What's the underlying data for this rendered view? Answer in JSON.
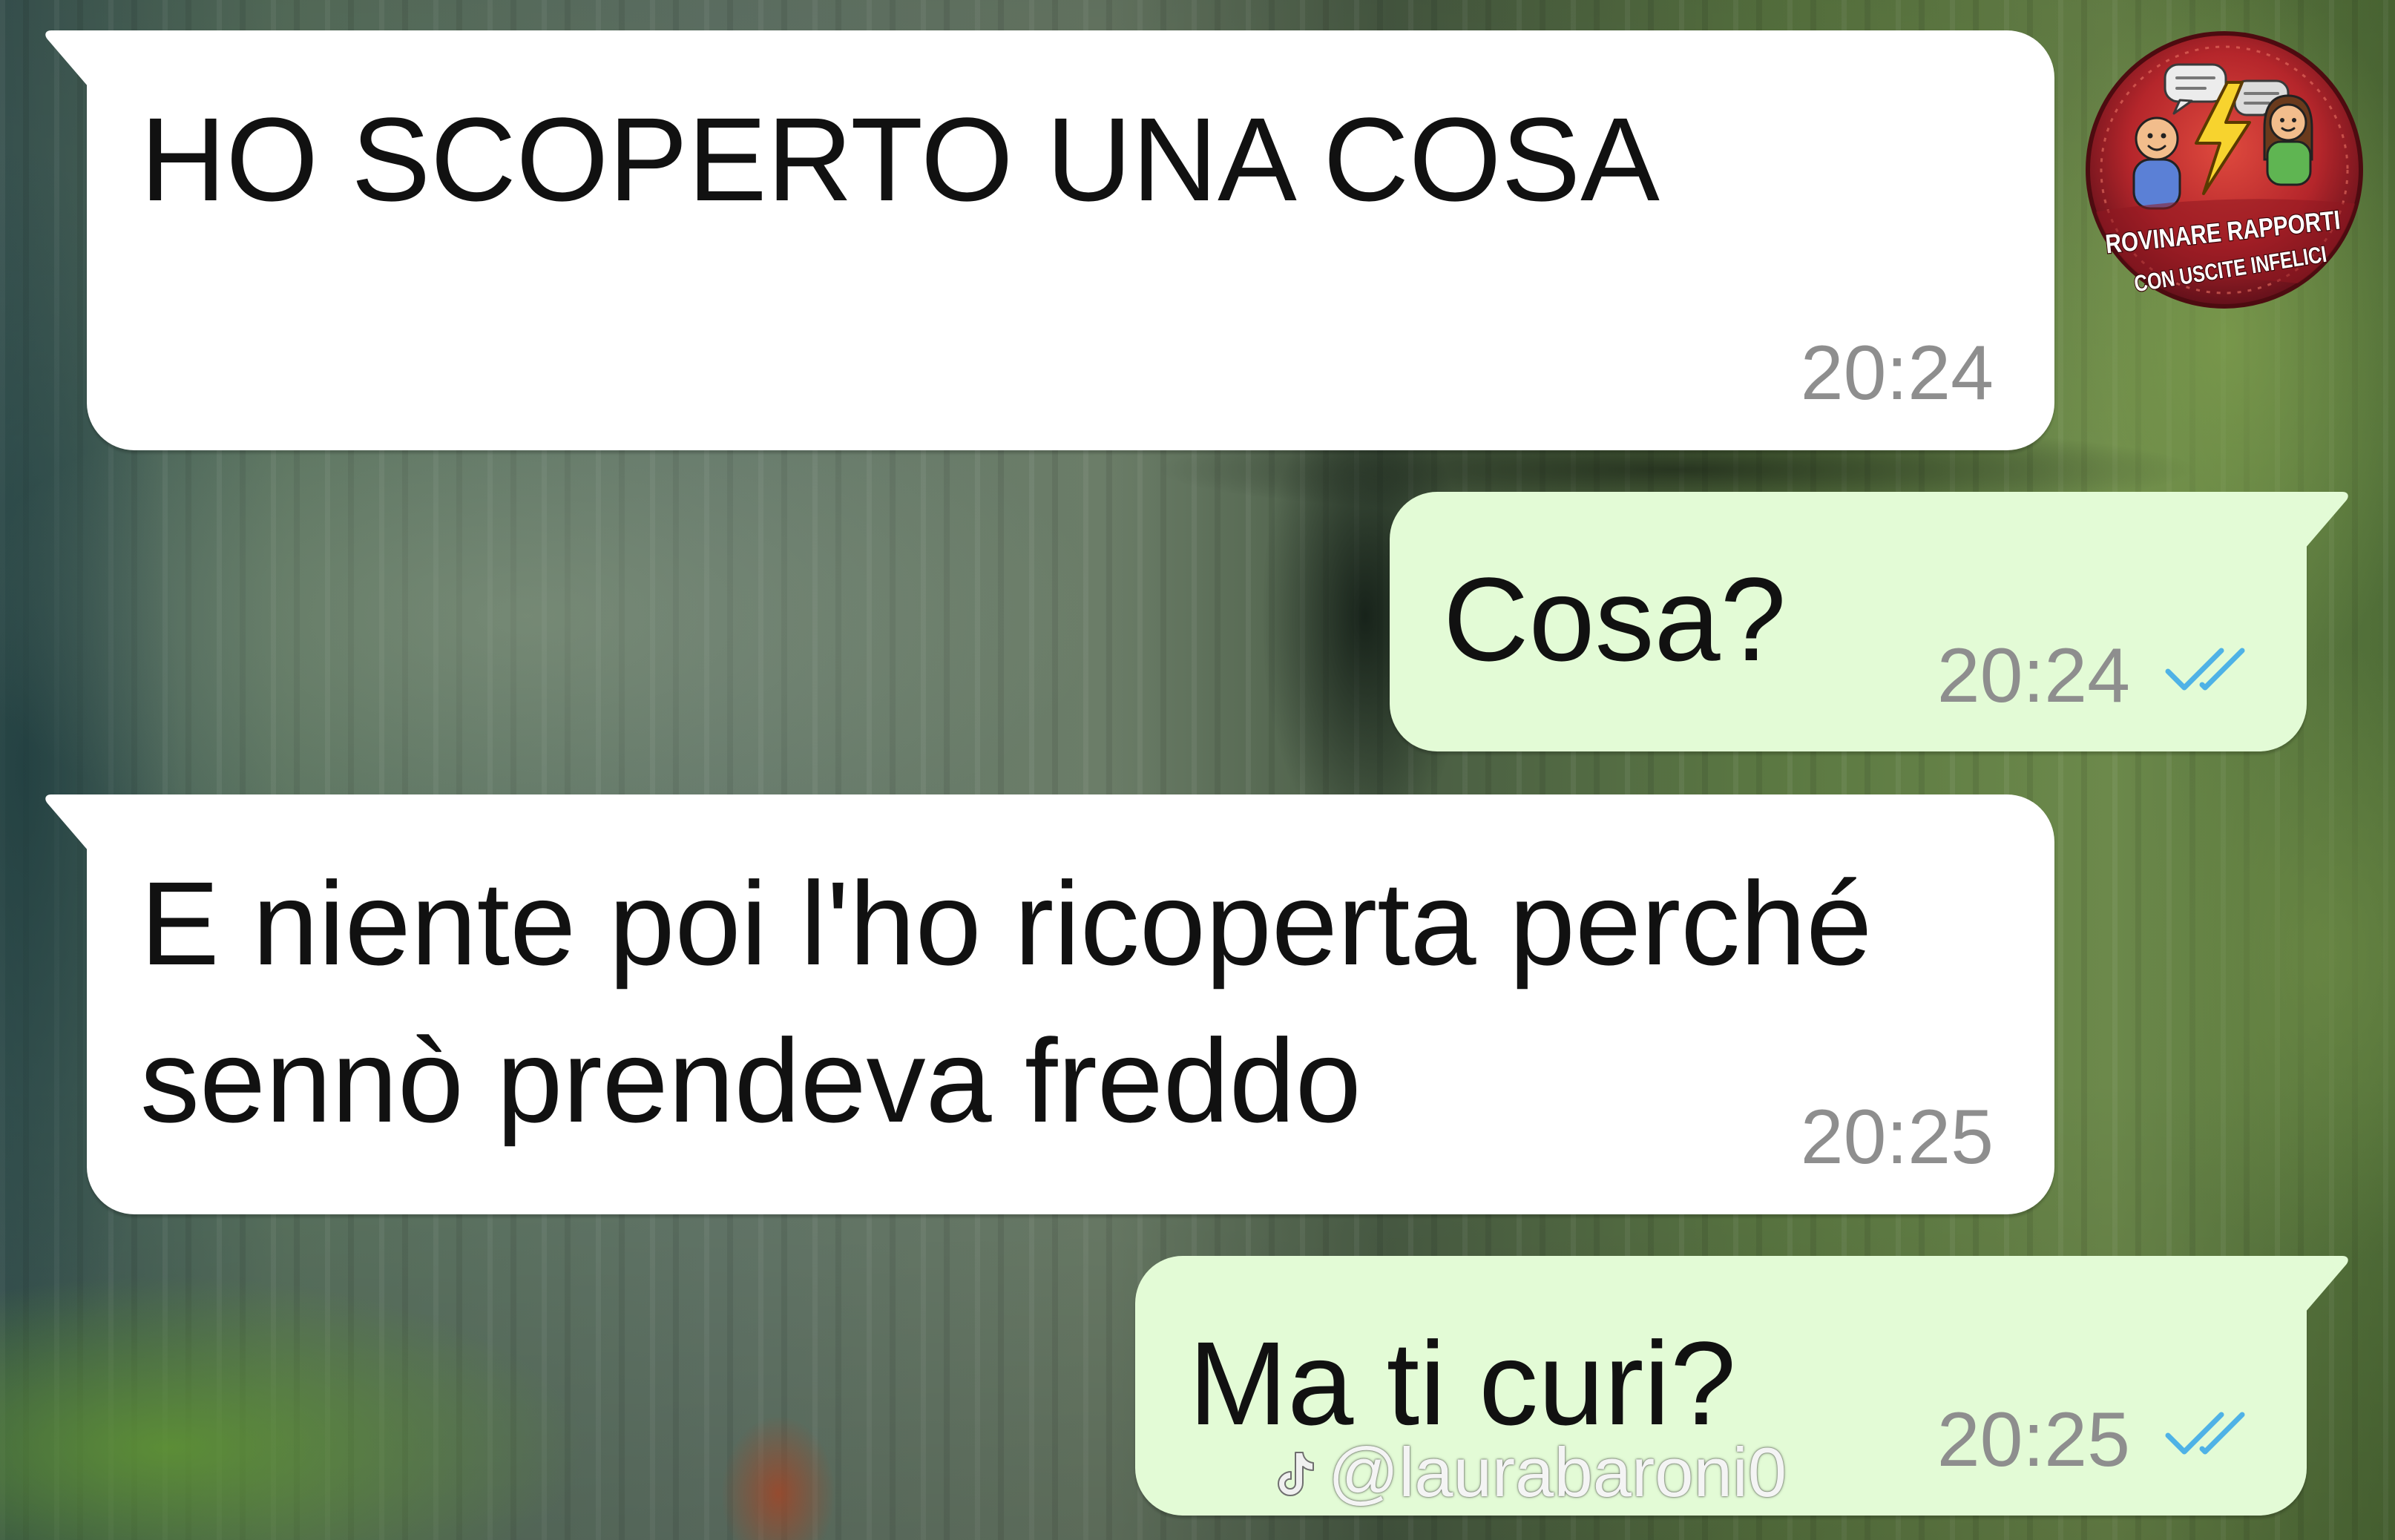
{
  "chat": {
    "messages": [
      {
        "lines": [
          "HO SCOPERTO UNA COSA"
        ],
        "time": "20:24"
      },
      {
        "lines": [
          "Cosa?"
        ],
        "time": "20:24",
        "status_icon": "double-check-icon"
      },
      {
        "lines": [
          "E niente poi l'ho ricoperta perché",
          "sennò prendeva freddo"
        ],
        "time": "20:25"
      },
      {
        "lines": [
          "Ma ti curi?"
        ],
        "time": "20:25",
        "status_icon": "double-check-icon"
      }
    ]
  },
  "badge": {
    "line1": "ROVINARE RAPPORTI",
    "line2": "CON USCITE INFELICI",
    "icons": [
      "speech-bubble-icon",
      "lightning-bolt-icon",
      "person-icon"
    ]
  },
  "watermark": {
    "icon": "tiktok-icon",
    "handle": "@laurabaroni0"
  },
  "colors": {
    "incoming_bubble": "#ffffff",
    "outgoing_bubble": "#e3fbd6",
    "message_text": "#111111",
    "timestamp": "#8e8e8e",
    "read_ticks": "#4fb2e6",
    "badge_red": "#b5262b"
  }
}
